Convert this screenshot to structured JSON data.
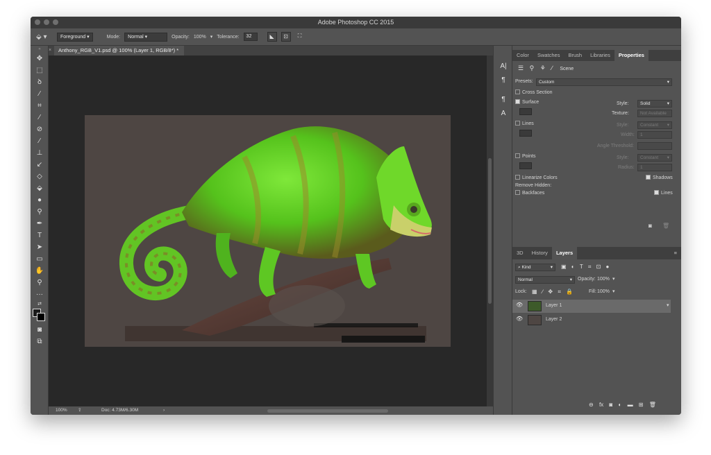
{
  "window": {
    "title": "Adobe Photoshop CC 2015"
  },
  "options": {
    "fill_source": "Foreground",
    "mode_label": "Mode:",
    "mode_value": "Normal",
    "opacity_label": "Opacity:",
    "opacity_value": "100%",
    "tolerance_label": "Tolerance:",
    "tolerance_value": "32"
  },
  "document": {
    "tab_title": "Anthony_RGB_V1.psd @ 100% (Layer 1, RGB/8*) *",
    "zoom": "100%",
    "doc_size": "Doc: 4.73M/6.30M"
  },
  "panel_tabs": [
    "Color",
    "Swatches",
    "Brush",
    "Libraries",
    "Properties"
  ],
  "properties": {
    "scene_label": "Scene",
    "presets_label": "Presets:",
    "presets_value": "Custom",
    "cross_section": "Cross Section",
    "surface": "Surface",
    "style_label": "Style:",
    "surface_style": "Solid",
    "texture_label": "Texture:",
    "texture_value": "Not Available",
    "lines": "Lines",
    "lines_style": "Constant",
    "width_label": "Width:",
    "width_value": "1",
    "angle_threshold": "Angle Threshold:",
    "points": "Points",
    "points_style": "Constant",
    "radius_label": "Radius:",
    "radius_value": "1",
    "linearize_colors": "Linearize Colors",
    "shadows": "Shadows",
    "remove_hidden": "Remove Hidden:",
    "backfaces": "Backfaces",
    "lines_check": "Lines"
  },
  "layers_tabs": [
    "3D",
    "History",
    "Layers"
  ],
  "layers": {
    "kind": "Kind",
    "blend_mode": "Normal",
    "opacity_label": "Opacity:",
    "opacity_value": "100%",
    "lock_label": "Lock:",
    "fill_label": "Fill:",
    "fill_value": "100%",
    "items": [
      "Layer 1",
      "Layer 2"
    ]
  },
  "colors": {
    "chrome": "#535353",
    "canvas_bg": "#282828",
    "doc_bg": "#4e4643",
    "chameleon_green": "#5fd11f"
  }
}
